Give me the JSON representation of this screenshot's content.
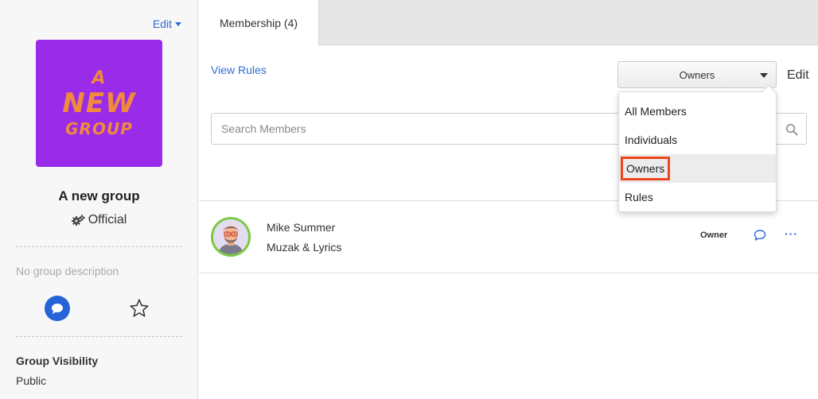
{
  "sidebar": {
    "edit_label": "Edit",
    "logo_text": [
      "A",
      "NEW",
      "GROUP"
    ],
    "group_name": "A new group",
    "group_type": "Official",
    "description": "No group description",
    "visibility_label": "Group Visibility",
    "visibility_value": "Public",
    "icons": [
      "chat-icon",
      "star-icon",
      "gears-icon"
    ]
  },
  "tabs": [
    {
      "label": "Membership (4)",
      "active": true
    }
  ],
  "toolbar": {
    "view_rules": "View Rules",
    "filter_selected": "Owners",
    "edit_label": "Edit"
  },
  "search": {
    "placeholder": "Search Members",
    "value": ""
  },
  "filter_menu": {
    "options": [
      "All Members",
      "Individuals",
      "Owners",
      "Rules"
    ],
    "selected": "Owners"
  },
  "members": [
    {
      "name": "Mike Summer",
      "subtitle": "Muzak & Lyrics",
      "role": "Owner"
    }
  ],
  "colors": {
    "accent": "#2f6ad9",
    "logo_bg": "#9a2be8",
    "logo_text": "#f08a3c",
    "highlight": "#f0461b",
    "avatar_ring": "#7ac943"
  }
}
